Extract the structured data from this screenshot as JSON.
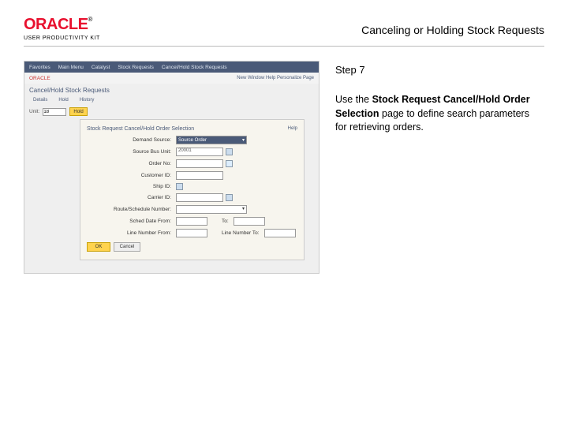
{
  "header": {
    "logo_text": "ORACLE",
    "logo_tm": "®",
    "upk": "USER PRODUCTIVITY KIT",
    "title": "Canceling or Holding Stock Requests"
  },
  "right": {
    "step": "Step 7",
    "instr_pre": "Use the ",
    "instr_bold": "Stock Request Cancel/Hold Order Selection",
    "instr_post": " page to define search parameters for retrieving orders."
  },
  "shot": {
    "nav": [
      "Favorites",
      "Main Menu",
      "Catalyst",
      "Stock Requests",
      "Cancel/Hold Stock Requests"
    ],
    "brand": "ORACLE",
    "links": "New Window  Help  Personalize Page",
    "breadcrumb": "",
    "section": "Cancel/Hold Stock Requests",
    "tabs": [
      "Details",
      "Hold",
      "History"
    ],
    "unit_label": "Unit:",
    "unit_value": "18",
    "hold_btn": "Hold",
    "form_title": "Stock Request Cancel/Hold Order Selection",
    "help": "Help",
    "fields": {
      "demand_source": "Demand Source:",
      "demand_source_val": "Source Order",
      "source_bu": "Source Bus Unit:",
      "source_bu_val": "20001",
      "order_no": "Order No:",
      "cust_id": "Customer ID:",
      "ship_id": "Ship ID:",
      "carrier": "Carrier ID:",
      "route": "Route/Schedule Number:",
      "sched_from": "Sched Date From:",
      "sched_to": "To:",
      "line_from": "Line Number From:",
      "line_to": "Line Number To:"
    },
    "ok": "OK",
    "cancel": "Cancel"
  }
}
